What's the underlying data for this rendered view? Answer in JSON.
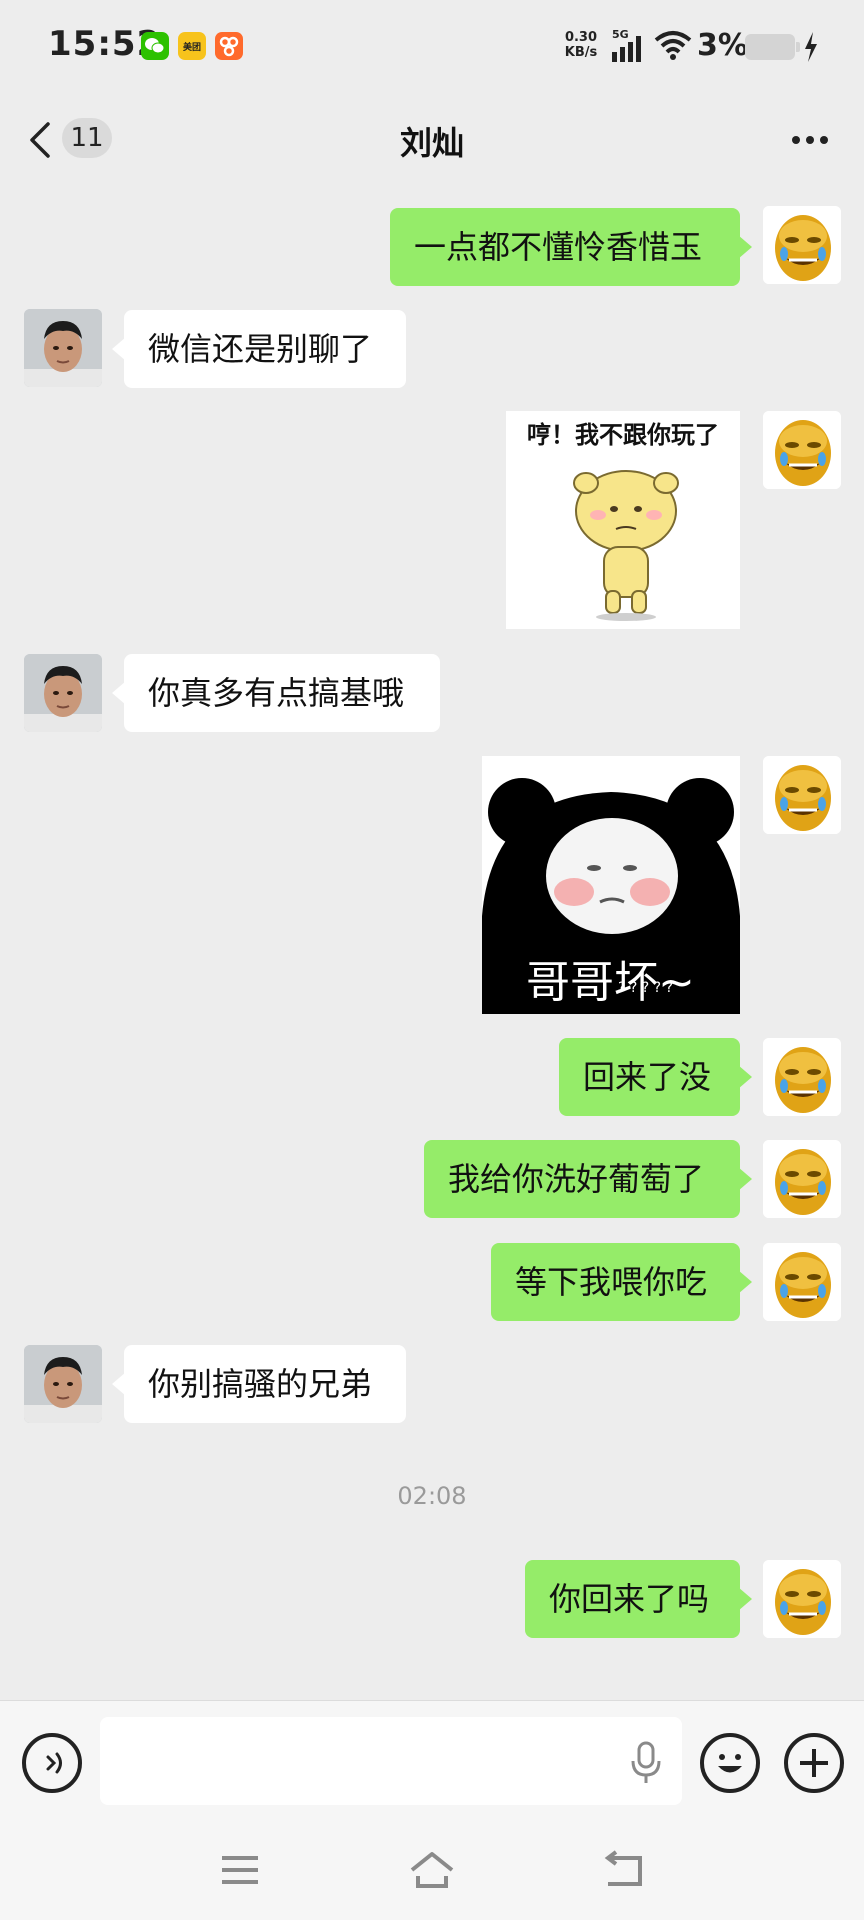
{
  "status_bar": {
    "time": "15:52",
    "app_icons": [
      "wechat-icon",
      "meituan-icon",
      "app-icon"
    ],
    "meituan_text": "美团",
    "network_speed_value": "0.30",
    "network_speed_unit": "KB/s",
    "network_type": "5G",
    "battery_percent": "3%"
  },
  "header": {
    "unread_count": "11",
    "title": "刘灿"
  },
  "messages": [
    {
      "sender": "me",
      "type": "text",
      "text": "一点都不懂怜香惜玉"
    },
    {
      "sender": "friend",
      "type": "text",
      "text": "微信还是别聊了"
    },
    {
      "sender": "me",
      "type": "sticker",
      "caption": "哼！我不跟你玩了"
    },
    {
      "sender": "friend",
      "type": "text",
      "text": "你真多有点搞基哦"
    },
    {
      "sender": "me",
      "type": "sticker",
      "caption": "哥哥坏~",
      "subcaption": "? ? ? ? ?"
    },
    {
      "sender": "me",
      "type": "text",
      "text": "回来了没"
    },
    {
      "sender": "me",
      "type": "text",
      "text": "我给你洗好葡萄了"
    },
    {
      "sender": "me",
      "type": "text",
      "text": "等下我喂你吃"
    },
    {
      "sender": "friend",
      "type": "text",
      "text": "你别搞骚的兄弟"
    },
    {
      "sender": "system",
      "type": "timestamp",
      "text": "02:08"
    },
    {
      "sender": "me",
      "type": "text",
      "text": "你回来了吗"
    }
  ],
  "colors": {
    "background": "#ededed",
    "my_bubble": "#95ec69",
    "friend_bubble": "#ffffff",
    "bottom_bar": "#f6f6f6"
  },
  "input_bar": {
    "text_value": "",
    "left_button_icon": "voice-icon",
    "right_icons": [
      "emoji-icon",
      "plus-icon"
    ],
    "mic_icon": "mic-icon"
  },
  "nav_bar": {
    "icons": [
      "menu-icon",
      "home-icon",
      "back-nav-icon"
    ]
  }
}
